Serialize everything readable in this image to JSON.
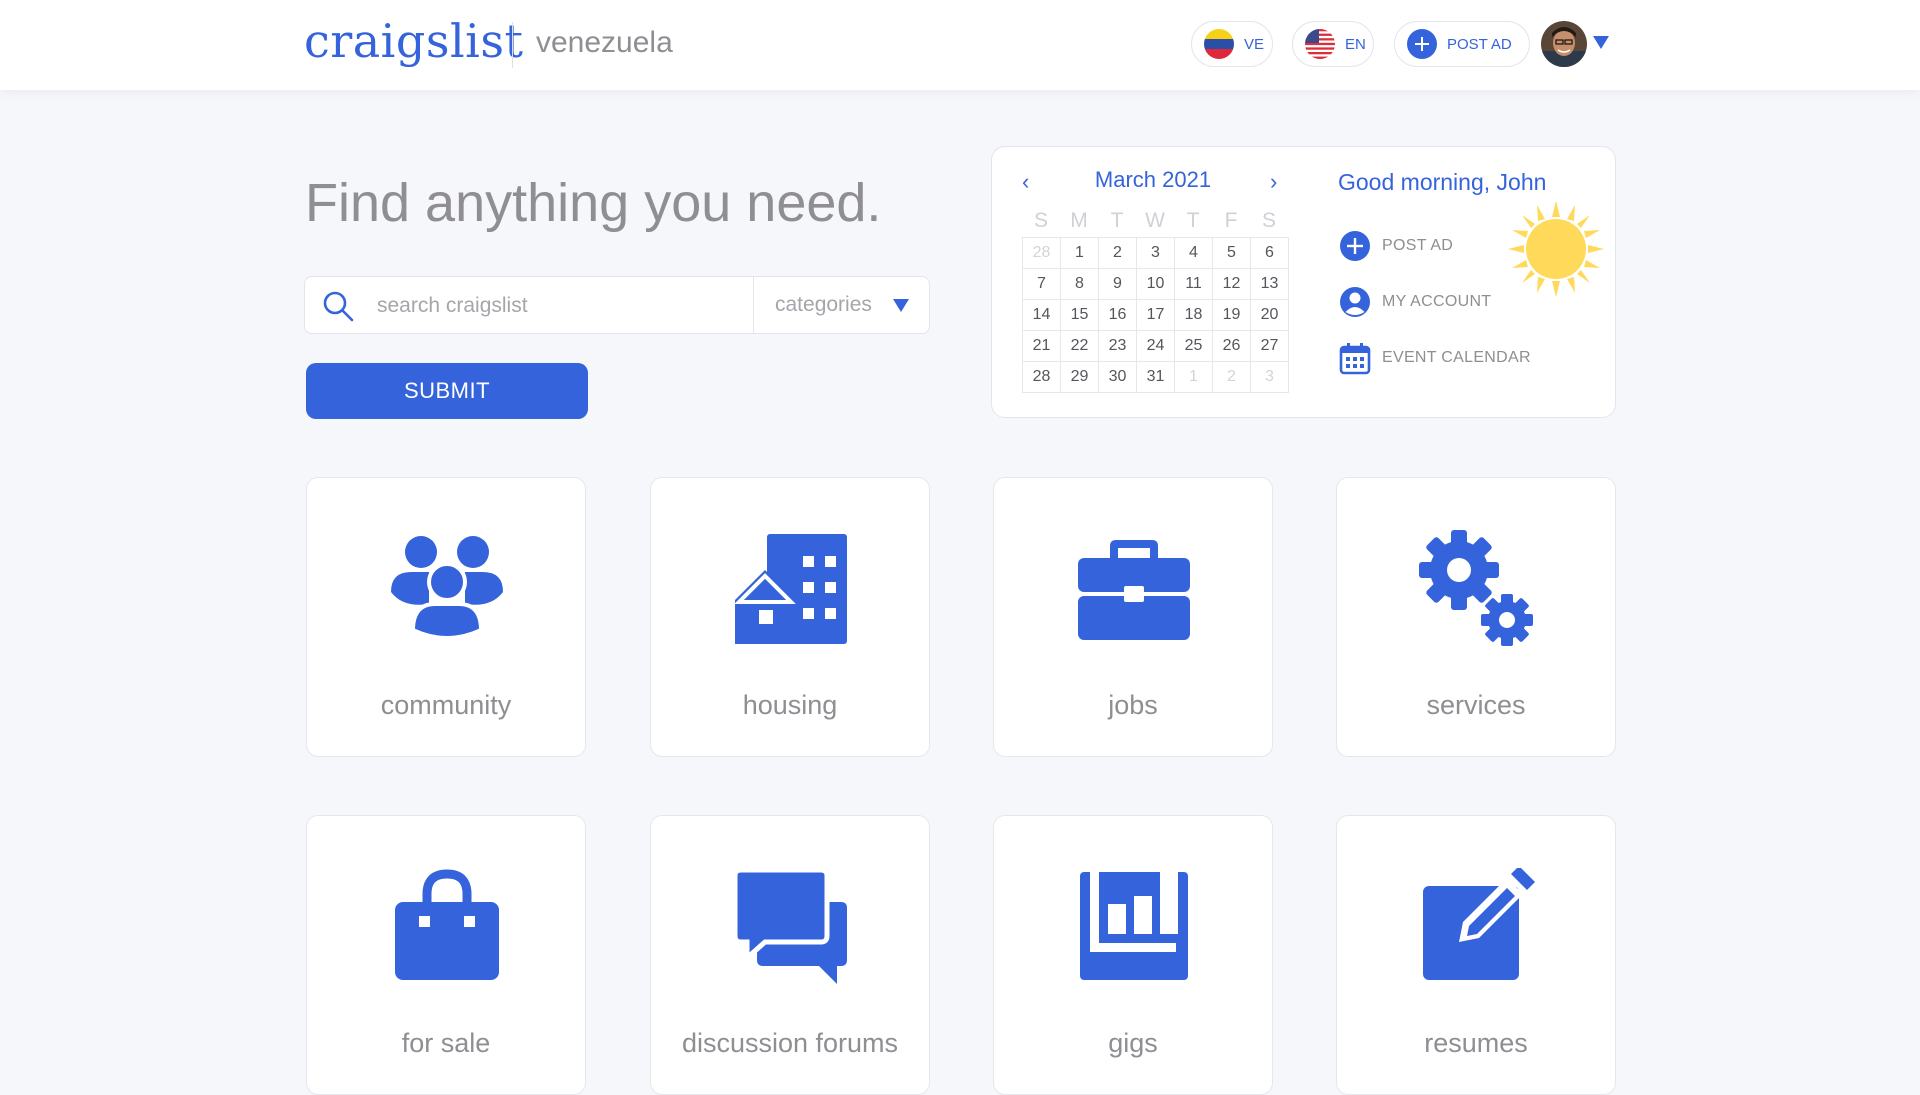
{
  "header": {
    "logo": "craigslist",
    "region": "venezuela",
    "country_label": "VE",
    "language_label": "EN",
    "post_ad_label": "POST AD"
  },
  "hero": {
    "title": "Find anything you need.",
    "search_placeholder": "search craigslist",
    "categories_label": "categories",
    "submit_label": "SUBMIT"
  },
  "calendar": {
    "month_label": "March 2021",
    "prev_icon": "‹",
    "next_icon": "›",
    "weekdays": [
      "S",
      "M",
      "T",
      "W",
      "T",
      "F",
      "S"
    ],
    "days": [
      "28",
      "1",
      "2",
      "3",
      "4",
      "5",
      "6",
      "7",
      "8",
      "9",
      "10",
      "11",
      "12",
      "13",
      "14",
      "15",
      "16",
      "17",
      "18",
      "19",
      "20",
      "21",
      "22",
      "23",
      "24",
      "25",
      "26",
      "27",
      "28",
      "29",
      "30",
      "31",
      "1",
      "2",
      "3"
    ]
  },
  "panel": {
    "greeting": "Good morning, John",
    "actions": [
      {
        "label": "POST AD",
        "icon": "plus-circle-icon"
      },
      {
        "label": "MY ACCOUNT",
        "icon": "user-circle-icon"
      },
      {
        "label": "EVENT CALENDAR",
        "icon": "calendar-icon"
      }
    ],
    "weather_icon": "sun-icon"
  },
  "categories": [
    {
      "label": "community",
      "icon": "people-icon"
    },
    {
      "label": "housing",
      "icon": "building-icon"
    },
    {
      "label": "jobs",
      "icon": "briefcase-icon"
    },
    {
      "label": "services",
      "icon": "gears-icon"
    },
    {
      "label": "for sale",
      "icon": "shopping-bag-icon"
    },
    {
      "label": "discussion forums",
      "icon": "chat-bubbles-icon"
    },
    {
      "label": "gigs",
      "icon": "gigs-chart-icon"
    },
    {
      "label": "resumes",
      "icon": "edit-icon"
    }
  ],
  "colors": {
    "accent": "#3563db",
    "background": "#f6f7fb",
    "text_muted": "#8e8e93",
    "sun": "#ffd95a"
  }
}
